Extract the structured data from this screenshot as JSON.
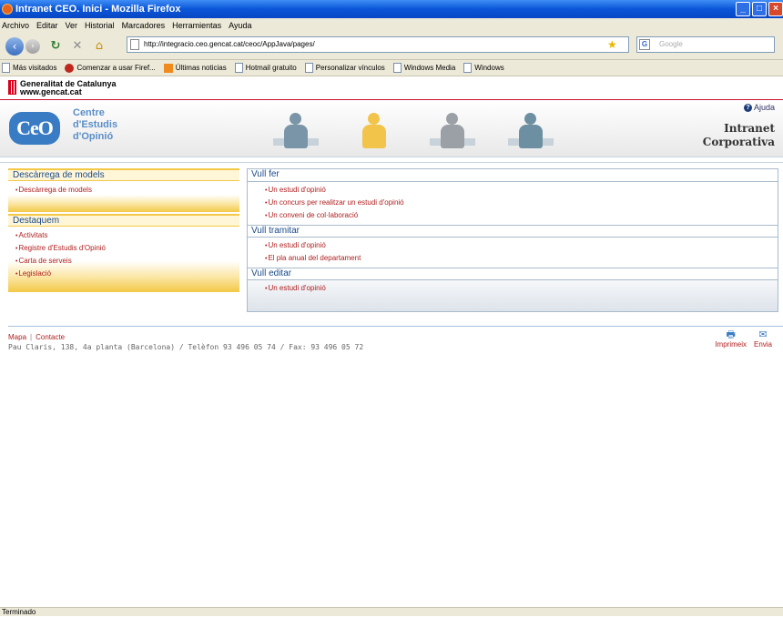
{
  "window": {
    "title": "Intranet CEO. Inici - Mozilla Firefox"
  },
  "menubar": [
    "Archivo",
    "Editar",
    "Ver",
    "Historial",
    "Marcadores",
    "Herramientas",
    "Ayuda"
  ],
  "navbar": {
    "url": "http://integracio.ceo.gencat.cat/ceoc/AppJava/pages/",
    "search_placeholder": "Google"
  },
  "bookmarks": [
    {
      "label": "Más visitados",
      "icon": "page-icon"
    },
    {
      "label": "Comenzar a usar Firef...",
      "icon": "firefox-icon"
    },
    {
      "label": "Últimas noticias",
      "icon": "rss-icon"
    },
    {
      "label": "Hotmail gratuito",
      "icon": "page-icon"
    },
    {
      "label": "Personalizar vínculos",
      "icon": "page-icon"
    },
    {
      "label": "Windows Media",
      "icon": "page-icon"
    },
    {
      "label": "Windows",
      "icon": "page-icon"
    }
  ],
  "gencat": {
    "line1": "Generalitat de Catalunya",
    "line2": "www.gencat.cat"
  },
  "header": {
    "logo_text": "CeO",
    "org_line1": "Centre",
    "org_line2": "d'Estudis",
    "org_line3": "d'Opinió",
    "help": "Ajuda",
    "intranet_line1": "Intranet",
    "intranet_line2": "Corporativa"
  },
  "left": {
    "box1": {
      "title": "Descàrrega de models",
      "items": [
        "Descàrrega de models"
      ]
    },
    "box2": {
      "title": "Destaquem",
      "items": [
        "Activitats",
        "Registre d'Estudis d'Opinió",
        "Carta de serveis",
        "Legislació"
      ]
    }
  },
  "right": {
    "sections": [
      {
        "title": "Vull fer",
        "items": [
          "Un estudi d'opinió",
          "Un concurs per realitzar un estudi d'opinió",
          "Un conveni de col·laboració"
        ]
      },
      {
        "title": "Vull tramitar",
        "items": [
          "Un estudi d'opinió",
          "El pla anual del departament"
        ]
      },
      {
        "title": "Vull editar",
        "items": [
          "Un estudi d'opinió"
        ]
      }
    ]
  },
  "footer": {
    "link_map": "Mapa",
    "link_contact": "Contacte",
    "address": "Pau Claris, 138, 4a planta (Barcelona) / Telèfon 93 496 05 74 / Fax: 93 496 05 72",
    "print": "Imprimeix",
    "send": "Envia"
  },
  "status": "Terminado",
  "colors": {
    "accent_blue": "#1a4a8a",
    "link_red": "#b02020",
    "gold": "#f3c847",
    "gencat_red": "#c8102e"
  }
}
